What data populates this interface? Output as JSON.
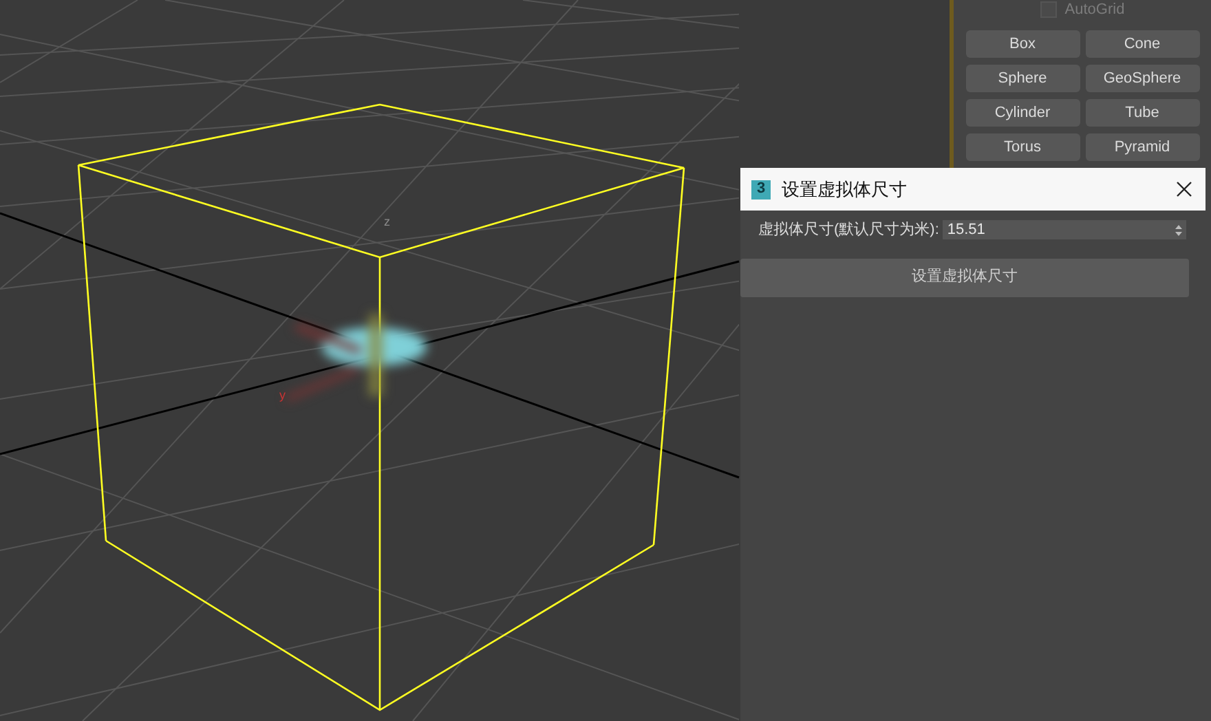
{
  "viewport": {
    "axis_labels": [
      {
        "kind": "z",
        "text": "z"
      },
      {
        "kind": "y",
        "text": "y"
      }
    ]
  },
  "command_panel": {
    "autogrid": {
      "label": "AutoGrid",
      "checked": false,
      "disabled": true
    },
    "buttons": [
      "Box",
      "Cone",
      "Sphere",
      "GeoSphere",
      "Cylinder",
      "Tube",
      "Torus",
      "Pyramid"
    ]
  },
  "dialog": {
    "icon_text": "3",
    "title": "设置虚拟体尺寸",
    "field": {
      "label": "虚拟体尺寸(默认尺寸为米):",
      "value": "15.51"
    },
    "button": "设置虚拟体尺寸"
  }
}
